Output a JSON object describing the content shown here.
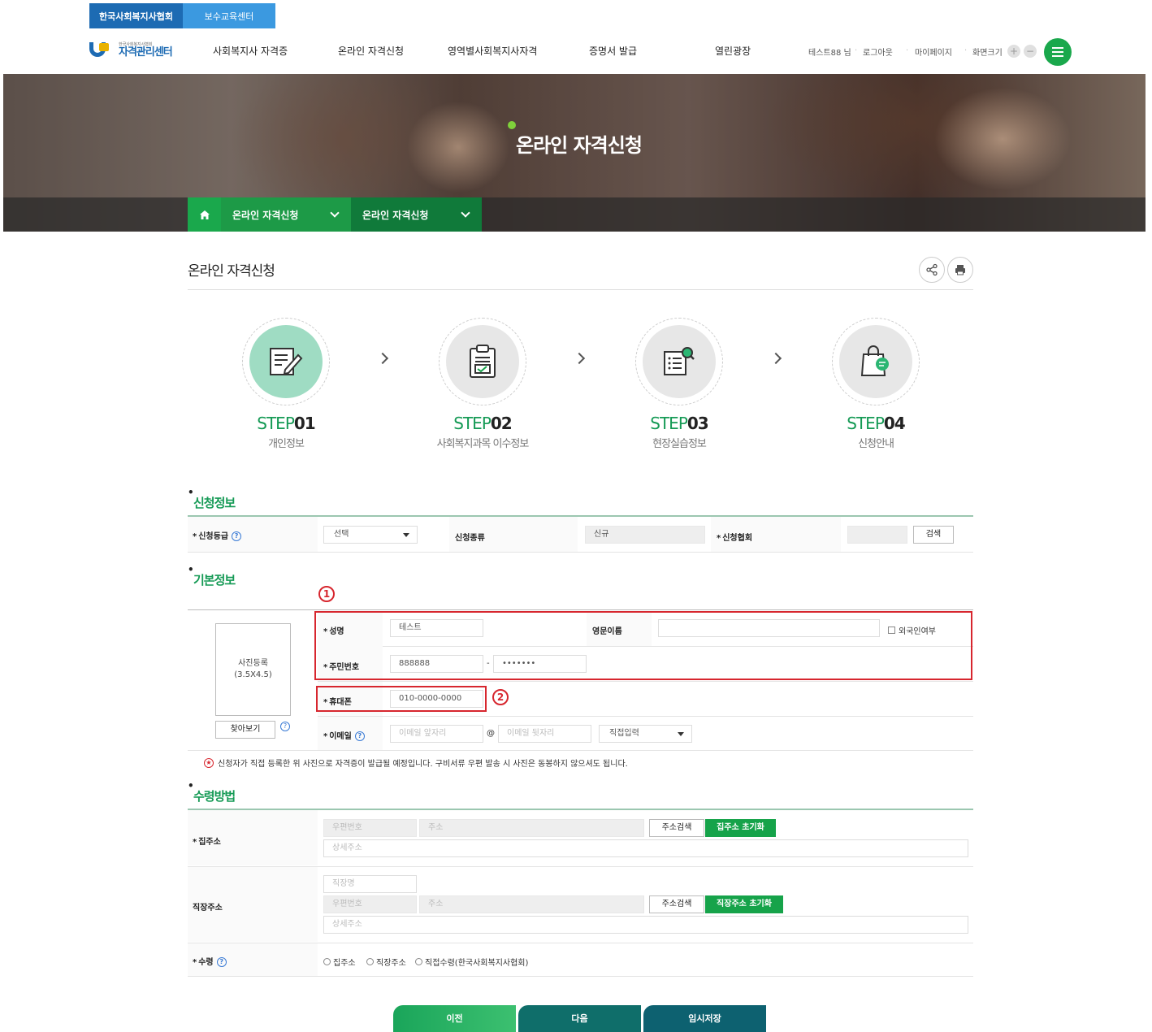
{
  "top_tabs": [
    "한국사회복지사협회",
    "보수교육센터"
  ],
  "logo": {
    "small": "한국사회복지사협회",
    "big": "자격관리센터"
  },
  "gnb": [
    "사회복지사 자격증",
    "온라인 자격신청",
    "영역별사회복지사자격",
    "증명서 발급",
    "열린광장"
  ],
  "util": {
    "user": "테스트88 님",
    "logout": "로그아웃",
    "mypage": "마이페이지",
    "font_size": "화면크기",
    "zoom_in": "+",
    "zoom_out": "−"
  },
  "hero": {
    "title": "온라인 자격신청"
  },
  "breadcrumb": [
    "온라인 자격신청",
    "온라인 자격신청"
  ],
  "page_title": "온라인 자격신청",
  "steps": [
    {
      "prefix": "STEP",
      "num": "01",
      "name": "개인정보",
      "active": true
    },
    {
      "prefix": "STEP",
      "num": "02",
      "name": "사회복지과목 이수정보",
      "active": false
    },
    {
      "prefix": "STEP",
      "num": "03",
      "name": "현장실습정보",
      "active": false
    },
    {
      "prefix": "STEP",
      "num": "04",
      "name": "신청안내",
      "active": false
    }
  ],
  "apply_info": {
    "title": "신청정보",
    "grade_label": "신청등급",
    "grade_value": "선택",
    "type_label": "신청종류",
    "type_value": "신규",
    "assoc_label": "신청협회",
    "search_button": "검색"
  },
  "basic_info": {
    "title": "기본정보",
    "marker1": "1",
    "marker2": "2",
    "photo_line1": "사진등록",
    "photo_line2": "(3.5X4.5)",
    "browse_button": "찾아보기",
    "name_label": "성명",
    "name_value": "테스트",
    "eng_name_label": "영문이름",
    "foreigner_label": "외국인여부",
    "rrn_label": "주민번호",
    "rrn_front": "888888",
    "rrn_dash": "-",
    "rrn_back": "•••••••",
    "phone_label": "휴대폰",
    "phone_value": "010-0000-0000",
    "email_label": "이메일",
    "email_front_ph": "이메일 앞자리",
    "email_at": "@",
    "email_back_ph": "이메일 뒷자리",
    "email_domain": "직접입력",
    "note": "신청자가 직접 등록한 위 사진으로 자격증이 발급될 예정입니다. 구비서류 우편 발송 시 사진은 동봉하지 않으셔도 됩니다."
  },
  "receive": {
    "title": "수령방법",
    "home_label": "집주소",
    "zip_ph": "우편번호",
    "addr_ph": "주소",
    "detail_ph": "상세주소",
    "addr_search": "주소검색",
    "home_reset": "집주소 초기화",
    "work_label": "직장주소",
    "work_name_ph": "직장명",
    "work_reset": "직장주소 초기화",
    "recv_label": "수령",
    "options": [
      "집주소",
      "직장주소",
      "직접수령(한국사회복지사협회)"
    ]
  },
  "buttons": {
    "prev": "이전",
    "next": "다음",
    "temp_save": "임시저장"
  },
  "colors": {
    "green": "#16a34a",
    "blue": "#1d6bb3",
    "red": "#d7262e"
  }
}
